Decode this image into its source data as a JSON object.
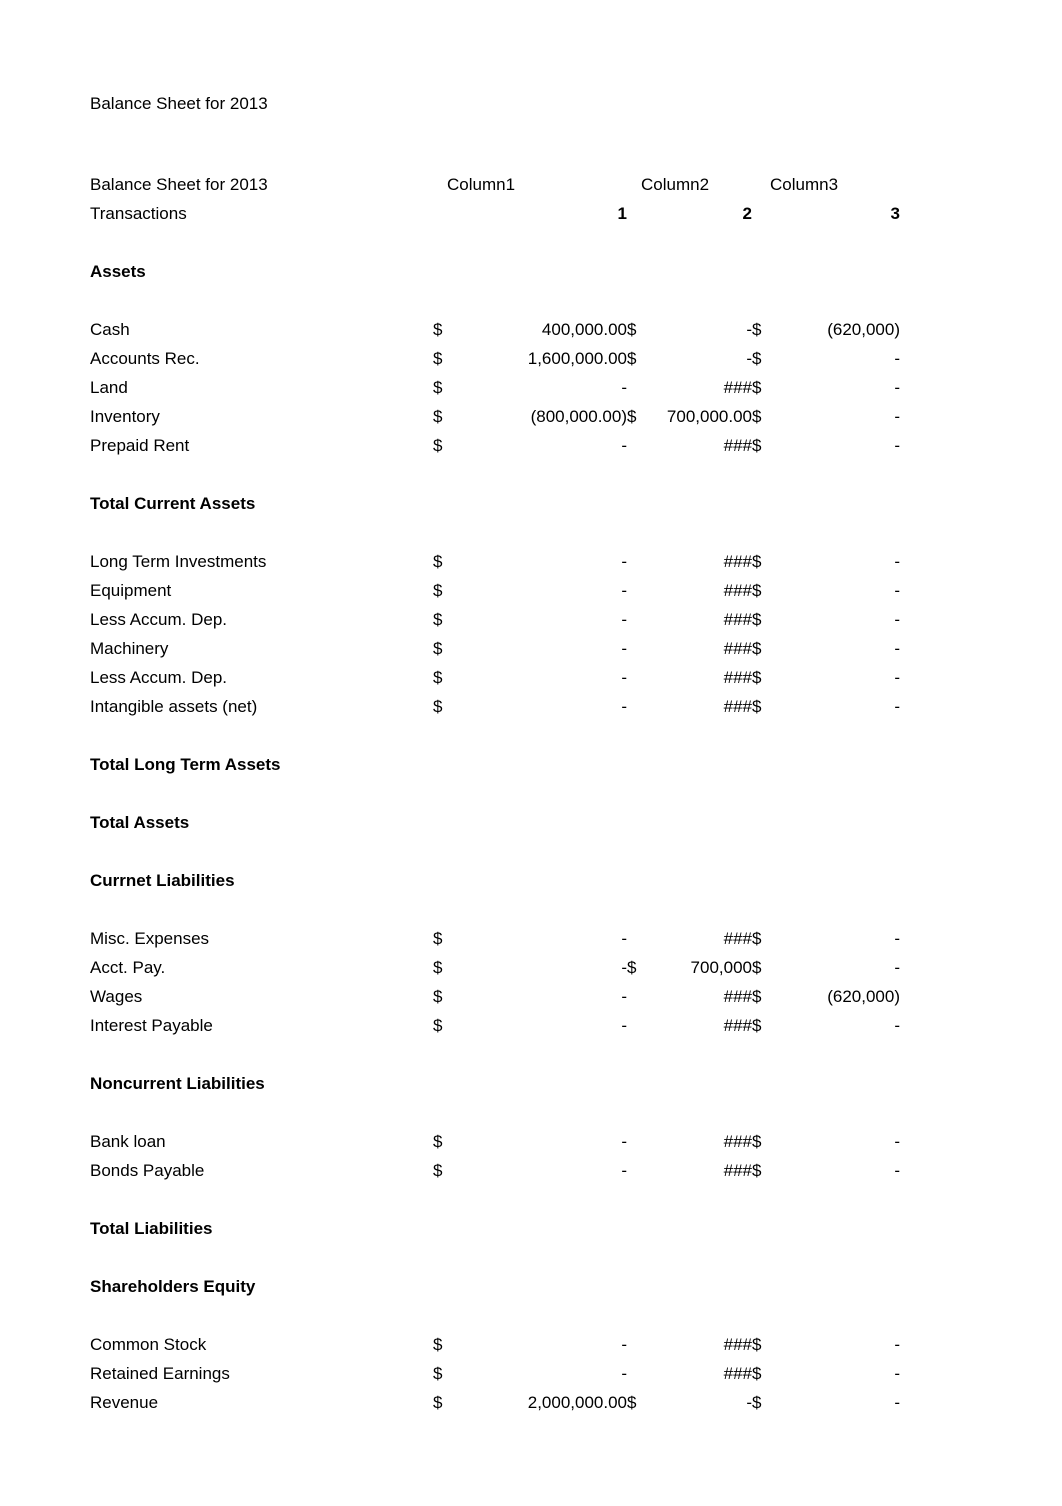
{
  "document": {
    "heading": "Balance Sheet for 2013"
  },
  "table": {
    "header": {
      "row_label": "Balance Sheet for 2013",
      "columns": [
        "Column1",
        "Column2",
        "Column3"
      ]
    },
    "subheader": {
      "row_label": "Transactions",
      "numbers": [
        "1",
        "2",
        "3"
      ]
    },
    "sections": [
      {
        "title": "Assets",
        "rows": [
          {
            "label": "Cash",
            "c1": "$",
            "v1": "400,000.00",
            "c2": "$",
            "v2": "-",
            "c3": "$",
            "v3": "(620,000)"
          },
          {
            "label": "Accounts Rec.",
            "c1": "$",
            "v1": "1,600,000.00",
            "c2": "$",
            "v2": "-",
            "c3": "$",
            "v3": "-"
          },
          {
            "label": "Land",
            "c1": "$",
            "v1": "-",
            "c2": "",
            "v2": "###",
            "c3": "$",
            "v3": "-"
          },
          {
            "label": "Inventory",
            "c1": "$",
            "v1": "(800,000.00)",
            "c2": "$",
            "v2": "700,000.00",
            "c3": "$",
            "v3": "-"
          },
          {
            "label": "Prepaid Rent",
            "c1": "$",
            "v1": "-",
            "c2": "",
            "v2": "###",
            "c3": "$",
            "v3": "-"
          }
        ]
      },
      {
        "title": "Total Current Assets",
        "rows": [
          {
            "label": "Long Term Investments",
            "c1": "$",
            "v1": "-",
            "c2": "",
            "v2": "###",
            "c3": "$",
            "v3": "-"
          },
          {
            "label": "Equipment",
            "c1": "$",
            "v1": "-",
            "c2": "",
            "v2": "###",
            "c3": "$",
            "v3": "-"
          },
          {
            "label": "Less Accum. Dep.",
            "c1": "$",
            "v1": "-",
            "c2": "",
            "v2": "###",
            "c3": "$",
            "v3": "-"
          },
          {
            "label": "Machinery",
            "c1": "$",
            "v1": "-",
            "c2": "",
            "v2": "###",
            "c3": "$",
            "v3": "-"
          },
          {
            "label": "Less Accum. Dep.",
            "c1": "$",
            "v1": "-",
            "c2": "",
            "v2": "###",
            "c3": "$",
            "v3": "-"
          },
          {
            "label": "Intangible assets (net)",
            "c1": "$",
            "v1": "-",
            "c2": "",
            "v2": "###",
            "c3": "$",
            "v3": "-"
          }
        ]
      },
      {
        "title": "Total Long Term Assets",
        "rows": []
      },
      {
        "title": "Total Assets",
        "rows": []
      },
      {
        "title": "Currnet Liabilities",
        "rows": [
          {
            "label": "Misc. Expenses",
            "c1": "$",
            "v1": "-",
            "c2": "",
            "v2": "###",
            "c3": "$",
            "v3": "-"
          },
          {
            "label": "Acct. Pay.",
            "c1": "$",
            "v1": "-",
            "c2": "$",
            "v2": "700,000",
            "c3": "$",
            "v3": "-"
          },
          {
            "label": "Wages",
            "c1": "$",
            "v1": "-",
            "c2": "",
            "v2": "###",
            "c3": "$",
            "v3": "(620,000)"
          },
          {
            "label": "Interest Payable",
            "c1": "$",
            "v1": "-",
            "c2": "",
            "v2": "###",
            "c3": "$",
            "v3": "-"
          }
        ]
      },
      {
        "title": "Noncurrent Liabilities",
        "rows": [
          {
            "label": "Bank loan",
            "c1": "$",
            "v1": "-",
            "c2": "",
            "v2": "###",
            "c3": "$",
            "v3": "-"
          },
          {
            "label": "Bonds Payable",
            "c1": "$",
            "v1": "-",
            "c2": "",
            "v2": "###",
            "c3": "$",
            "v3": "-"
          }
        ]
      },
      {
        "title": "Total Liabilities",
        "rows": []
      },
      {
        "title": "Shareholders Equity",
        "rows": [
          {
            "label": "Common Stock",
            "c1": "$",
            "v1": "-",
            "c2": "",
            "v2": "###",
            "c3": "$",
            "v3": "-"
          },
          {
            "label": "Retained Earnings",
            "c1": "$",
            "v1": "-",
            "c2": "",
            "v2": "###",
            "c3": "$",
            "v3": "-"
          },
          {
            "label": "Revenue",
            "c1": "$",
            "v1": "2,000,000.00",
            "c2": "$",
            "v2": "-",
            "c3": "$",
            "v3": "-"
          }
        ]
      }
    ]
  }
}
